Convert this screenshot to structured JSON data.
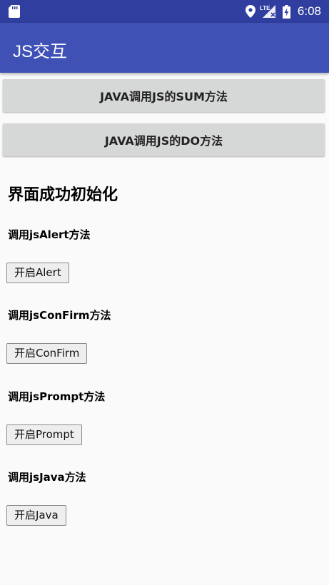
{
  "status_bar": {
    "time": "6:08",
    "network_label": "LTE",
    "icons": [
      "sd-card-icon",
      "location-icon",
      "signal-icon",
      "battery-icon"
    ]
  },
  "app_bar": {
    "title": "JS交互"
  },
  "buttons": {
    "sum_label": "JAVA调用JS的SUM方法",
    "do_label": "JAVA调用JS的DO方法"
  },
  "web": {
    "title": "界面成功初始化",
    "sections": [
      {
        "heading": "调用jsAlert方法",
        "button": "开启Alert"
      },
      {
        "heading": "调用jsConFirm方法",
        "button": "开启ConFirm"
      },
      {
        "heading": "调用jsPrompt方法",
        "button": "开启Prompt"
      },
      {
        "heading": "调用jsJava方法",
        "button": "开启Java"
      }
    ]
  },
  "colors": {
    "status_bar": "#303f9f",
    "app_bar": "#3f51b5",
    "button_bg": "#d6d7d7",
    "page_bg": "#fafafa"
  }
}
